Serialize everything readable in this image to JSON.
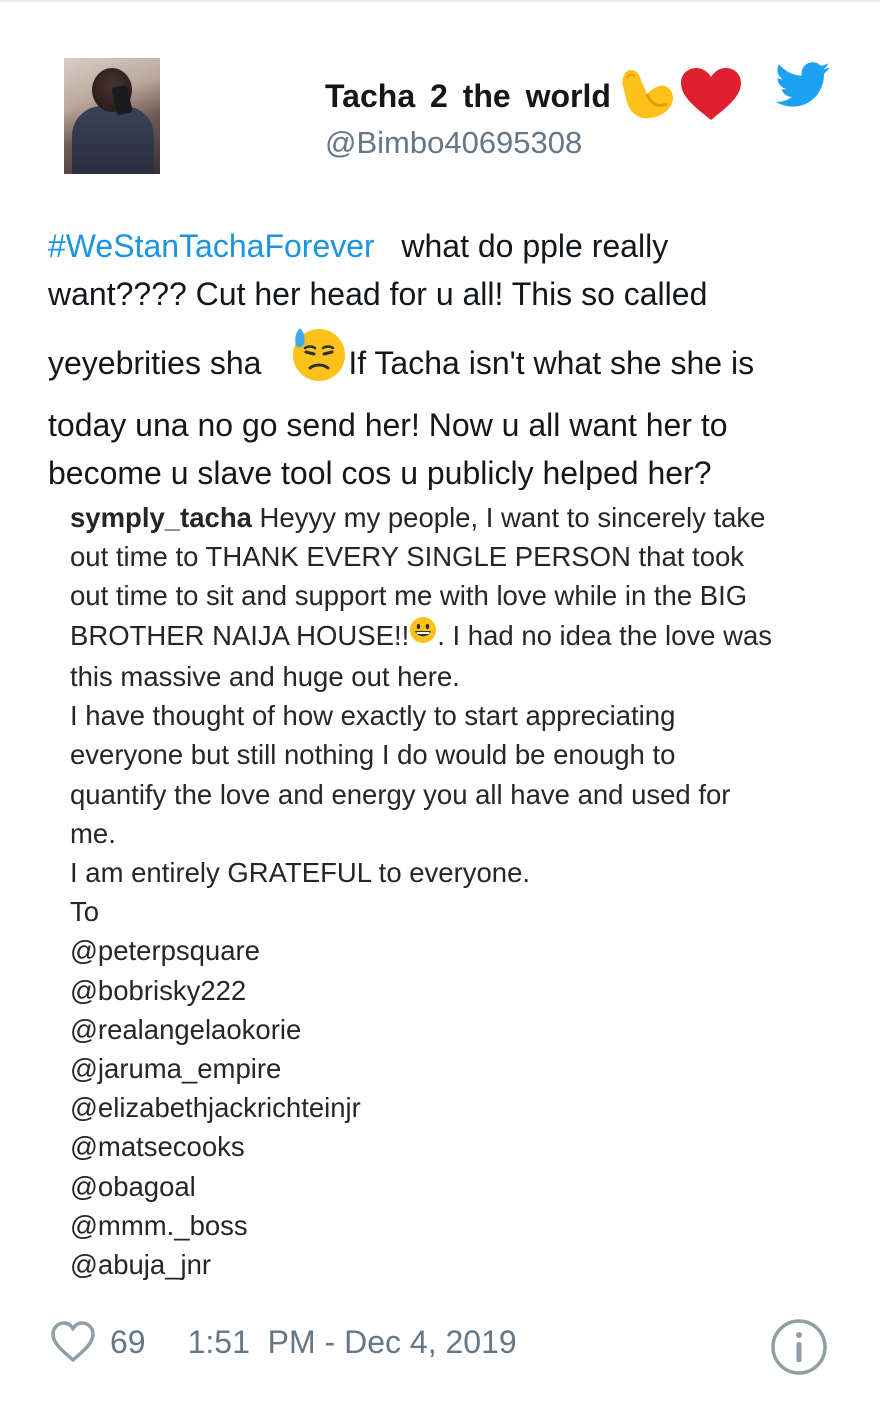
{
  "tweet": {
    "author": {
      "display_name": "Tacha 2 the world",
      "name_emojis": [
        "flexed-biceps",
        "red-heart"
      ],
      "handle": "@Bimbo40695308"
    },
    "text_lines": [
      {
        "hashtag": "#WeStanTachaForever",
        "rest": "   what do pple really"
      },
      {
        "text": "want???? Cut her head for u all! This so called"
      },
      {
        "before": "yeyebrities sha ",
        "emoji": "downcast-face-with-sweat",
        "after": "If Tacha isn't what she she is"
      },
      {
        "text": "today una no go send her! Now u all want her to"
      },
      {
        "text": "become u slave tool cos u publicly helped her?"
      }
    ],
    "embedded_post": {
      "username": "symply_tacha",
      "lines": [
        {
          "first": " Heyyy my people, I want to sincerely take"
        },
        {
          "text": "out time to THANK EVERY SINGLE PERSON that took"
        },
        {
          "text": "out time to sit and support me with love while in the BIG"
        },
        {
          "before": "BROTHER NAIJA HOUSE!!",
          "emoji": "grinning-face",
          "after": ". I had no idea the love was"
        },
        {
          "text": "this massive and huge out here."
        },
        {
          "text": "I have thought of how exactly to start appreciating"
        },
        {
          "text": "everyone but still nothing I do would be enough to"
        },
        {
          "text": "quantify the love and energy you all have and used for"
        },
        {
          "text": "me."
        },
        {
          "text": "I am entirely GRATEFUL to everyone."
        },
        {
          "text": "To"
        },
        {
          "text": "@peterpsquare"
        },
        {
          "text": "@bobrisky222"
        },
        {
          "text": "@realangelaokorie"
        },
        {
          "text": "@jaruma_empire"
        },
        {
          "text": "@elizabethjackrichteinjr"
        },
        {
          "text": "@matsecooks"
        },
        {
          "text": "@obagoal"
        },
        {
          "text": "@mmm._boss"
        },
        {
          "text": "@abuja_jnr"
        }
      ]
    },
    "footer": {
      "like_count": "69",
      "timestamp": "1:51  PM - Dec 4, 2019"
    }
  },
  "colors": {
    "hashtag": "#1b95e0",
    "twitter_blue": "#1da1f2",
    "secondary_text": "#657786",
    "heart_icon": "#8ea0a5",
    "info_icon": "#8ea0a5"
  }
}
